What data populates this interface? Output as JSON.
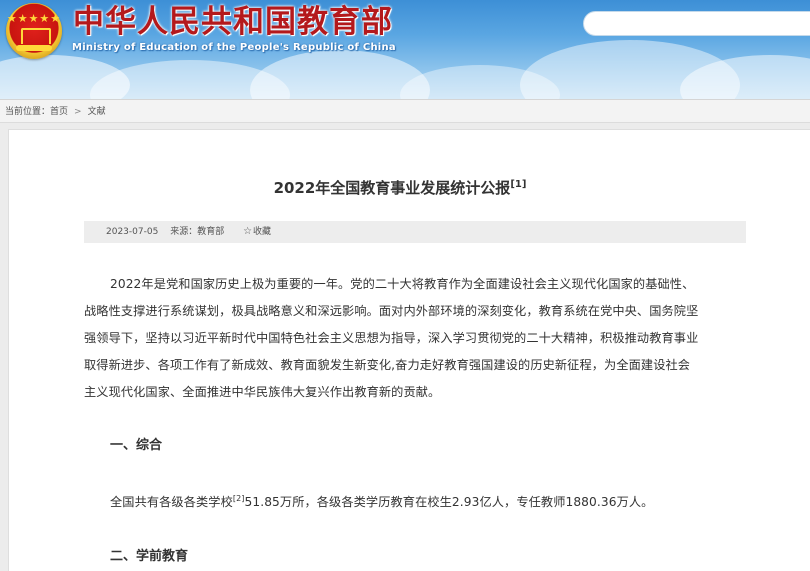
{
  "header": {
    "site_title": "中华人民共和国教育部",
    "site_subtitle": "Ministry of Education of the People's Republic of China",
    "search": {
      "placeholder": "",
      "icon": "search-icon"
    },
    "emblem_colors": {
      "red": "#c8140f",
      "gold": "#ffd93a"
    }
  },
  "breadcrumb": {
    "prefix": "当前位置：",
    "home": "首页",
    "separator": ">",
    "current": "文献"
  },
  "article": {
    "title": "2022年全国教育事业发展统计公报",
    "title_footnote": "[1]",
    "meta": {
      "date": "2023-07-05",
      "source": "来源：教育部",
      "favorite_icon": "☆",
      "favorite": "收藏"
    },
    "intro_lines": [
      "2022年是党和国家历史上极为重要的一年。党的二十大将教育作为全面建设社会主义现代化国家的基础性、",
      "战略性支撑进行系统谋划，极具战略意义和深远影响。面对内外部环境的深刻变化，教育系统在党中央、国务院坚",
      "强领导下，坚持以习近平新时代中国特色社会主义思想为指导，深入学习贯彻党的二十大精神，积极推动教育事业",
      "取得新进步、各项工作有了新成效、教育面貌发生新变化,奋力走好教育强国建设的历史新征程，为全面建设社会",
      "主义现代化国家、全面推进中华民族伟大复兴作出教育新的贡献。"
    ],
    "section1": {
      "heading": "一、综合",
      "text_before": "全国共有各级各类学校",
      "footnote": "[2]",
      "text_after": "51.85万所，各级各类学历教育在校生2.93亿人，专任教师1880.36万人。"
    },
    "section2": {
      "heading": "二、学前教育"
    }
  }
}
